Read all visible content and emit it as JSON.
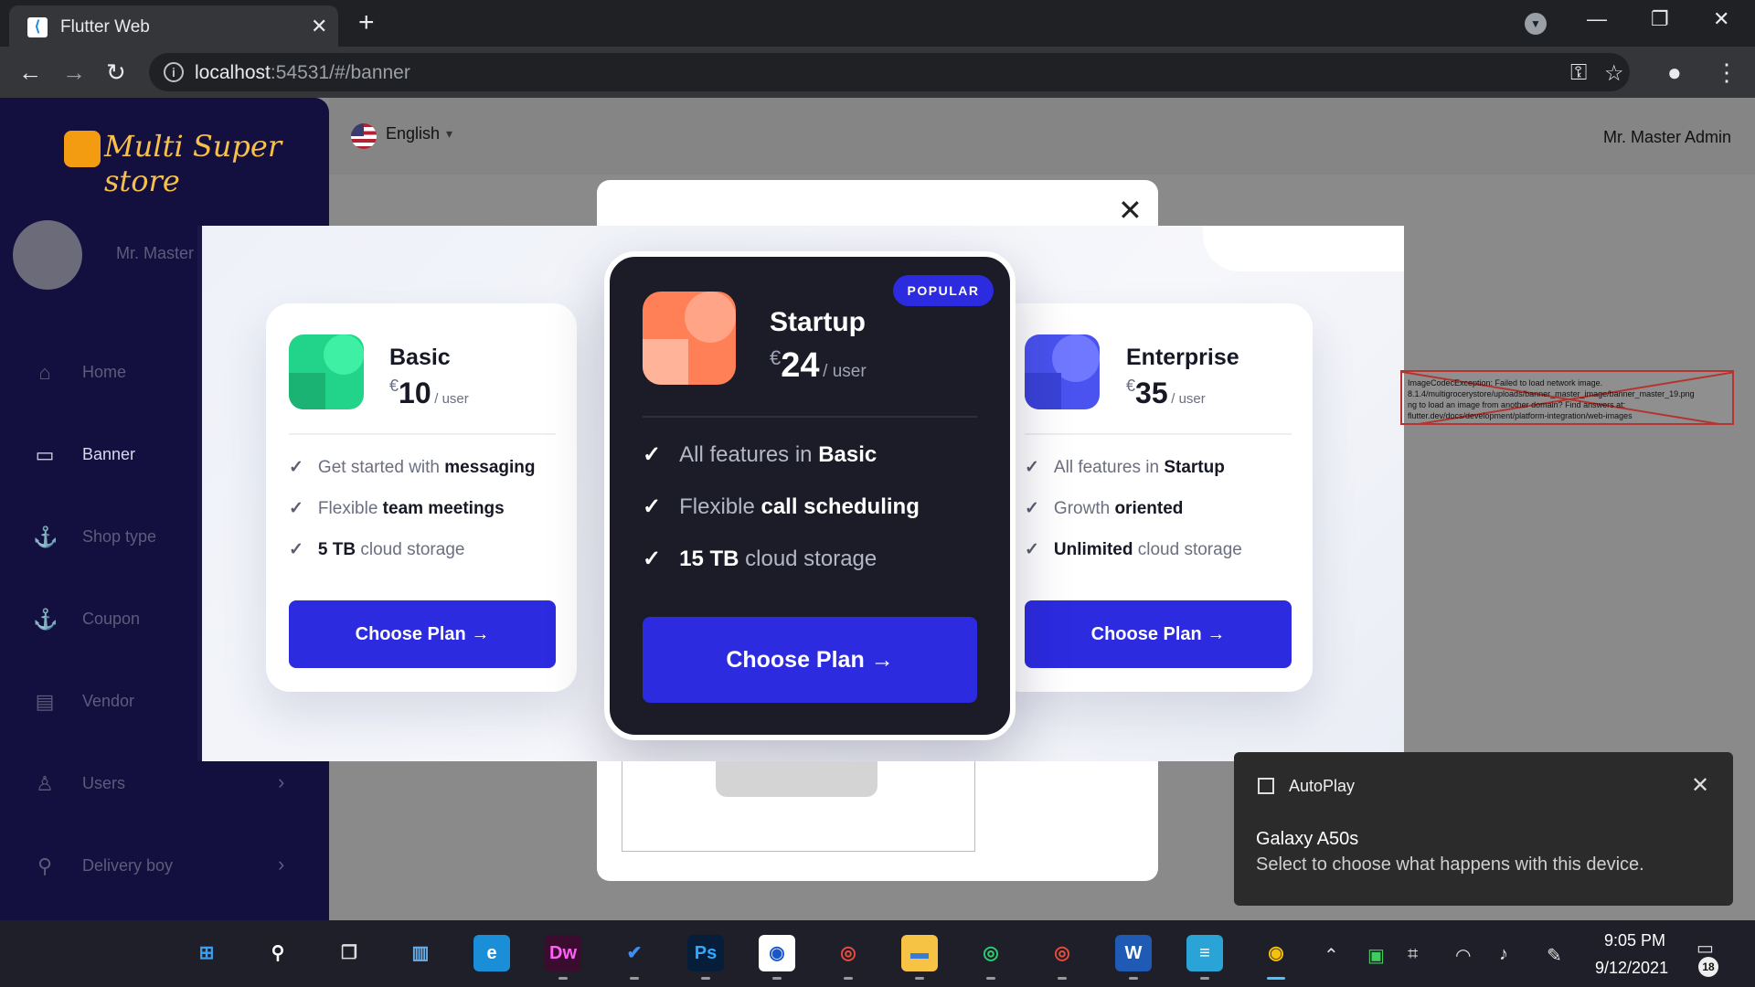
{
  "browser": {
    "tab_title": "Flutter Web",
    "tab_close": "✕",
    "new_tab": "+",
    "url_host": "localhost",
    "url_rest": ":54531/#/banner",
    "minimize": "—",
    "restore": "❐",
    "close": "✕"
  },
  "sidebar": {
    "logo_text": "Multi Super store",
    "user_name": "Mr. Master",
    "items": [
      {
        "label": "Home",
        "icon": "home-icon",
        "glyph": "⌂",
        "active": false,
        "has_chevron": false
      },
      {
        "label": "Banner",
        "icon": "monitor-icon",
        "glyph": "▭",
        "active": true,
        "has_chevron": false
      },
      {
        "label": "Shop type",
        "icon": "anchor-icon",
        "glyph": "⚓",
        "active": false,
        "has_chevron": false
      },
      {
        "label": "Coupon",
        "icon": "anchor-icon",
        "glyph": "⚓",
        "active": false,
        "has_chevron": false
      },
      {
        "label": "Vendor",
        "icon": "store-icon",
        "glyph": "▤",
        "active": false,
        "has_chevron": false
      },
      {
        "label": "Users",
        "icon": "user-icon",
        "glyph": "♙",
        "active": false,
        "has_chevron": true
      },
      {
        "label": "Delivery boy",
        "icon": "bike-icon",
        "glyph": "⚲",
        "active": false,
        "has_chevron": true
      }
    ]
  },
  "topbar": {
    "language": "English",
    "admin_name": "Mr. Master Admin"
  },
  "dialog": {
    "close_glyph": "✕"
  },
  "pricing": {
    "currency": "€",
    "per_user": "/ user",
    "popular_badge": "POPULAR",
    "button_label": "Choose Plan",
    "button_arrow": "→",
    "plans": [
      {
        "name": "Basic",
        "price": "10",
        "features": [
          [
            "Get started with ",
            "messaging",
            ""
          ],
          [
            "Flexible ",
            "team meetings",
            ""
          ],
          [
            "",
            "5 TB",
            " cloud storage"
          ]
        ]
      },
      {
        "name": "Startup",
        "price": "24",
        "features": [
          [
            "All features in ",
            "Basic",
            ""
          ],
          [
            "Flexible ",
            "call scheduling",
            ""
          ],
          [
            "",
            "15 TB",
            " cloud storage"
          ]
        ]
      },
      {
        "name": "Enterprise",
        "price": "35",
        "features": [
          [
            "All features in ",
            "Startup",
            ""
          ],
          [
            "Growth ",
            "oriented",
            ""
          ],
          [
            "",
            "Unlimited",
            " cloud storage"
          ]
        ]
      }
    ],
    "colors": {
      "basic": "#22d48a",
      "startup": "#ff8a63",
      "enterprise": "#4a52f0",
      "button": "#2c2be0"
    }
  },
  "error_overlay": {
    "lines": [
      "ImageCodecException: Failed to load network image.",
      "8.1.4/multigrocerystore/uploads/banner_master_image/banner_master_19.png",
      "ng to load an image from another domain? Find answers at:",
      "flutter.dev/docs/development/platform-integration/web-images"
    ]
  },
  "toast": {
    "title": "AutoPlay",
    "heading": "Galaxy A50s",
    "message": "Select to choose what happens with this device.",
    "close": "✕"
  },
  "taskbar": {
    "time": "9:05 PM",
    "date": "9/12/2021",
    "notifications": "18",
    "apps": [
      {
        "name": "start-icon",
        "label": "⊞",
        "bg": "transparent",
        "color": "#3aa0f0"
      },
      {
        "name": "search-icon",
        "label": "⚲",
        "bg": "transparent",
        "color": "#ffffff"
      },
      {
        "name": "task-view-icon",
        "label": "❐",
        "bg": "transparent",
        "color": "#dddddd"
      },
      {
        "name": "widgets-icon",
        "label": "▥",
        "bg": "transparent",
        "color": "#6aaee8"
      },
      {
        "name": "edge-icon",
        "label": "e",
        "bg": "#1a8fd8",
        "color": "#ffffff"
      },
      {
        "name": "dreamweaver-icon",
        "label": "Dw",
        "bg": "#3a0c2d",
        "color": "#ff61f6"
      },
      {
        "name": "todo-icon",
        "label": "✔",
        "bg": "transparent",
        "color": "#3f8ef0"
      },
      {
        "name": "photoshop-icon",
        "label": "Ps",
        "bg": "#061e3a",
        "color": "#31a8ff"
      },
      {
        "name": "app-icon",
        "label": "◉",
        "bg": "#ffffff",
        "color": "#1a56c8"
      },
      {
        "name": "chrome-profile-icon",
        "label": "◎",
        "bg": "transparent",
        "color": "#e74c3c"
      },
      {
        "name": "file-explorer-icon",
        "label": "▬",
        "bg": "#f6c344",
        "color": "#3a7bd5"
      },
      {
        "name": "chrome-profile2-icon",
        "label": "◎",
        "bg": "transparent",
        "color": "#2ecc71"
      },
      {
        "name": "chrome-profile3-icon",
        "label": "◎",
        "bg": "transparent",
        "color": "#e74c3c"
      },
      {
        "name": "word-icon",
        "label": "W",
        "bg": "#1f5bb5",
        "color": "#ffffff"
      },
      {
        "name": "notepad-icon",
        "label": "≡",
        "bg": "#2aa4d6",
        "color": "#ffffff"
      },
      {
        "name": "chrome-icon",
        "label": "◉",
        "bg": "transparent",
        "color": "#f4c20d"
      }
    ]
  }
}
